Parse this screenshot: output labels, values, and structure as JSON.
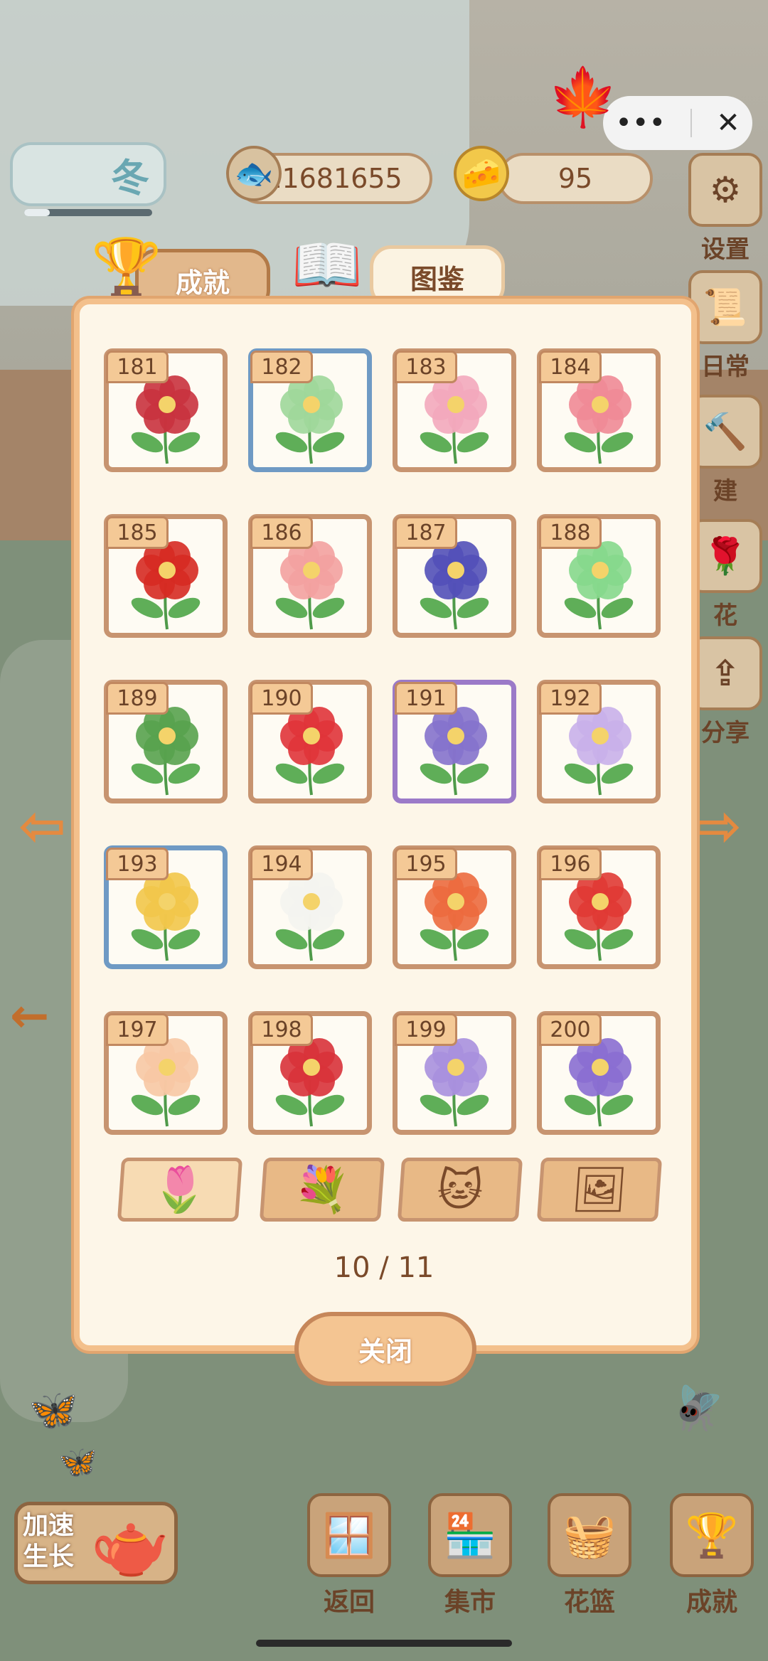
{
  "hud": {
    "season_label": "冬",
    "season_progress": 0.2,
    "fish_count": "11681655",
    "cheese_count": "95"
  },
  "side_menu": [
    {
      "label": "设置",
      "icon": "gear-icon"
    },
    {
      "label": "日常",
      "icon": "scroll-icon"
    },
    {
      "label": "建",
      "icon": "hammer-icon"
    },
    {
      "label": "花",
      "icon": "flower-icon"
    },
    {
      "label": "分享",
      "icon": "share-icon"
    }
  ],
  "tabs": {
    "achievements": "成就",
    "encyclopedia": "图鉴"
  },
  "cards": [
    {
      "num": "181",
      "color": "#c9323e",
      "frame": "normal"
    },
    {
      "num": "182",
      "color": "#9fd79a",
      "frame": "blue"
    },
    {
      "num": "183",
      "color": "#f3a9bd",
      "frame": "normal"
    },
    {
      "num": "184",
      "color": "#f08a96",
      "frame": "normal"
    },
    {
      "num": "185",
      "color": "#d62a22",
      "frame": "normal"
    },
    {
      "num": "186",
      "color": "#f3a1a0",
      "frame": "normal"
    },
    {
      "num": "187",
      "color": "#5250b8",
      "frame": "normal"
    },
    {
      "num": "188",
      "color": "#86d88c",
      "frame": "normal"
    },
    {
      "num": "189",
      "color": "#58a24e",
      "frame": "normal"
    },
    {
      "num": "190",
      "color": "#e0343a",
      "frame": "normal"
    },
    {
      "num": "191",
      "color": "#8572cc",
      "frame": "purple"
    },
    {
      "num": "192",
      "color": "#c9b0ea",
      "frame": "normal"
    },
    {
      "num": "193",
      "color": "#f2c64a",
      "frame": "blue"
    },
    {
      "num": "194",
      "color": "#f4f4f0",
      "frame": "normal"
    },
    {
      "num": "195",
      "color": "#ec6a3e",
      "frame": "normal"
    },
    {
      "num": "196",
      "color": "#e03a34",
      "frame": "normal"
    },
    {
      "num": "197",
      "color": "#f7c8a4",
      "frame": "normal"
    },
    {
      "num": "198",
      "color": "#d8323a",
      "frame": "normal"
    },
    {
      "num": "199",
      "color": "#a890de",
      "frame": "normal"
    },
    {
      "num": "200",
      "color": "#8a6ed2",
      "frame": "normal"
    }
  ],
  "categories": [
    {
      "icon": "flower-icon",
      "symbol": "🌷",
      "selected": true
    },
    {
      "icon": "bouquet-icon",
      "symbol": "💐",
      "selected": false
    },
    {
      "icon": "cat-silhouette-icon",
      "symbol": "🐱",
      "selected": false
    },
    {
      "icon": "photo-card-icon",
      "symbol": "🖼",
      "selected": false
    }
  ],
  "pagination": "10 / 11",
  "close_label": "关闭",
  "speed_label": "加速生长",
  "bottom_nav": [
    {
      "label": "返回",
      "icon": "window-icon",
      "symbol": "🪟"
    },
    {
      "label": "集市",
      "icon": "market-stall-icon",
      "symbol": "🏪"
    },
    {
      "label": "花篮",
      "icon": "basket-icon",
      "symbol": "🧺"
    },
    {
      "label": "成就",
      "icon": "trophy-icon",
      "symbol": "🏆"
    }
  ]
}
